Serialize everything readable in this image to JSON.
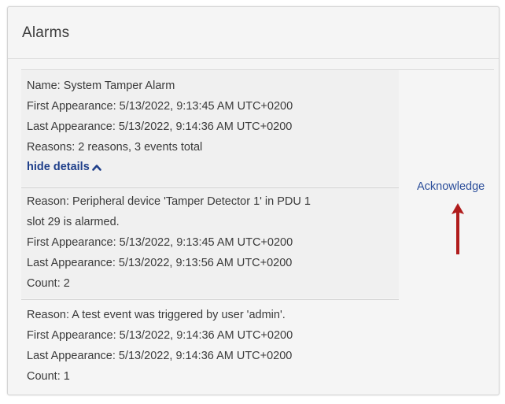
{
  "panel": {
    "title": "Alarms"
  },
  "alarm": {
    "name_line": "Name: System Tamper Alarm",
    "first_appearance_line": "First Appearance: 5/13/2022, 9:13:45 AM UTC+0200",
    "last_appearance_line": "Last Appearance: 5/13/2022, 9:14:36 AM UTC+0200",
    "reasons_line": "Reasons: 2 reasons, 3 events total",
    "toggle_label": "hide details",
    "acknowledge_label": "Acknowledge",
    "reasons": [
      {
        "reason_line_1": "Reason: Peripheral device 'Tamper Detector 1' in PDU 1",
        "reason_line_2": "slot 29 is alarmed.",
        "first_appearance_line": "First Appearance: 5/13/2022, 9:13:45 AM UTC+0200",
        "last_appearance_line": "Last Appearance: 5/13/2022, 9:13:56 AM UTC+0200",
        "count_line": "Count: 2"
      },
      {
        "reason_line_1": "Reason: A test event was triggered by user 'admin'.",
        "first_appearance_line": "First Appearance: 5/13/2022, 9:14:36 AM UTC+0200",
        "last_appearance_line": "Last Appearance: 5/13/2022, 9:14:36 AM UTC+0200",
        "count_line": "Count: 1"
      }
    ]
  },
  "icons": {
    "toggle_icon": "chevron-up-icon",
    "annotation": "arrow-up-icon"
  },
  "colors": {
    "link": "#2a4d9a",
    "toggle": "#1f3f8a",
    "annotation_arrow": "#b01c1c"
  }
}
